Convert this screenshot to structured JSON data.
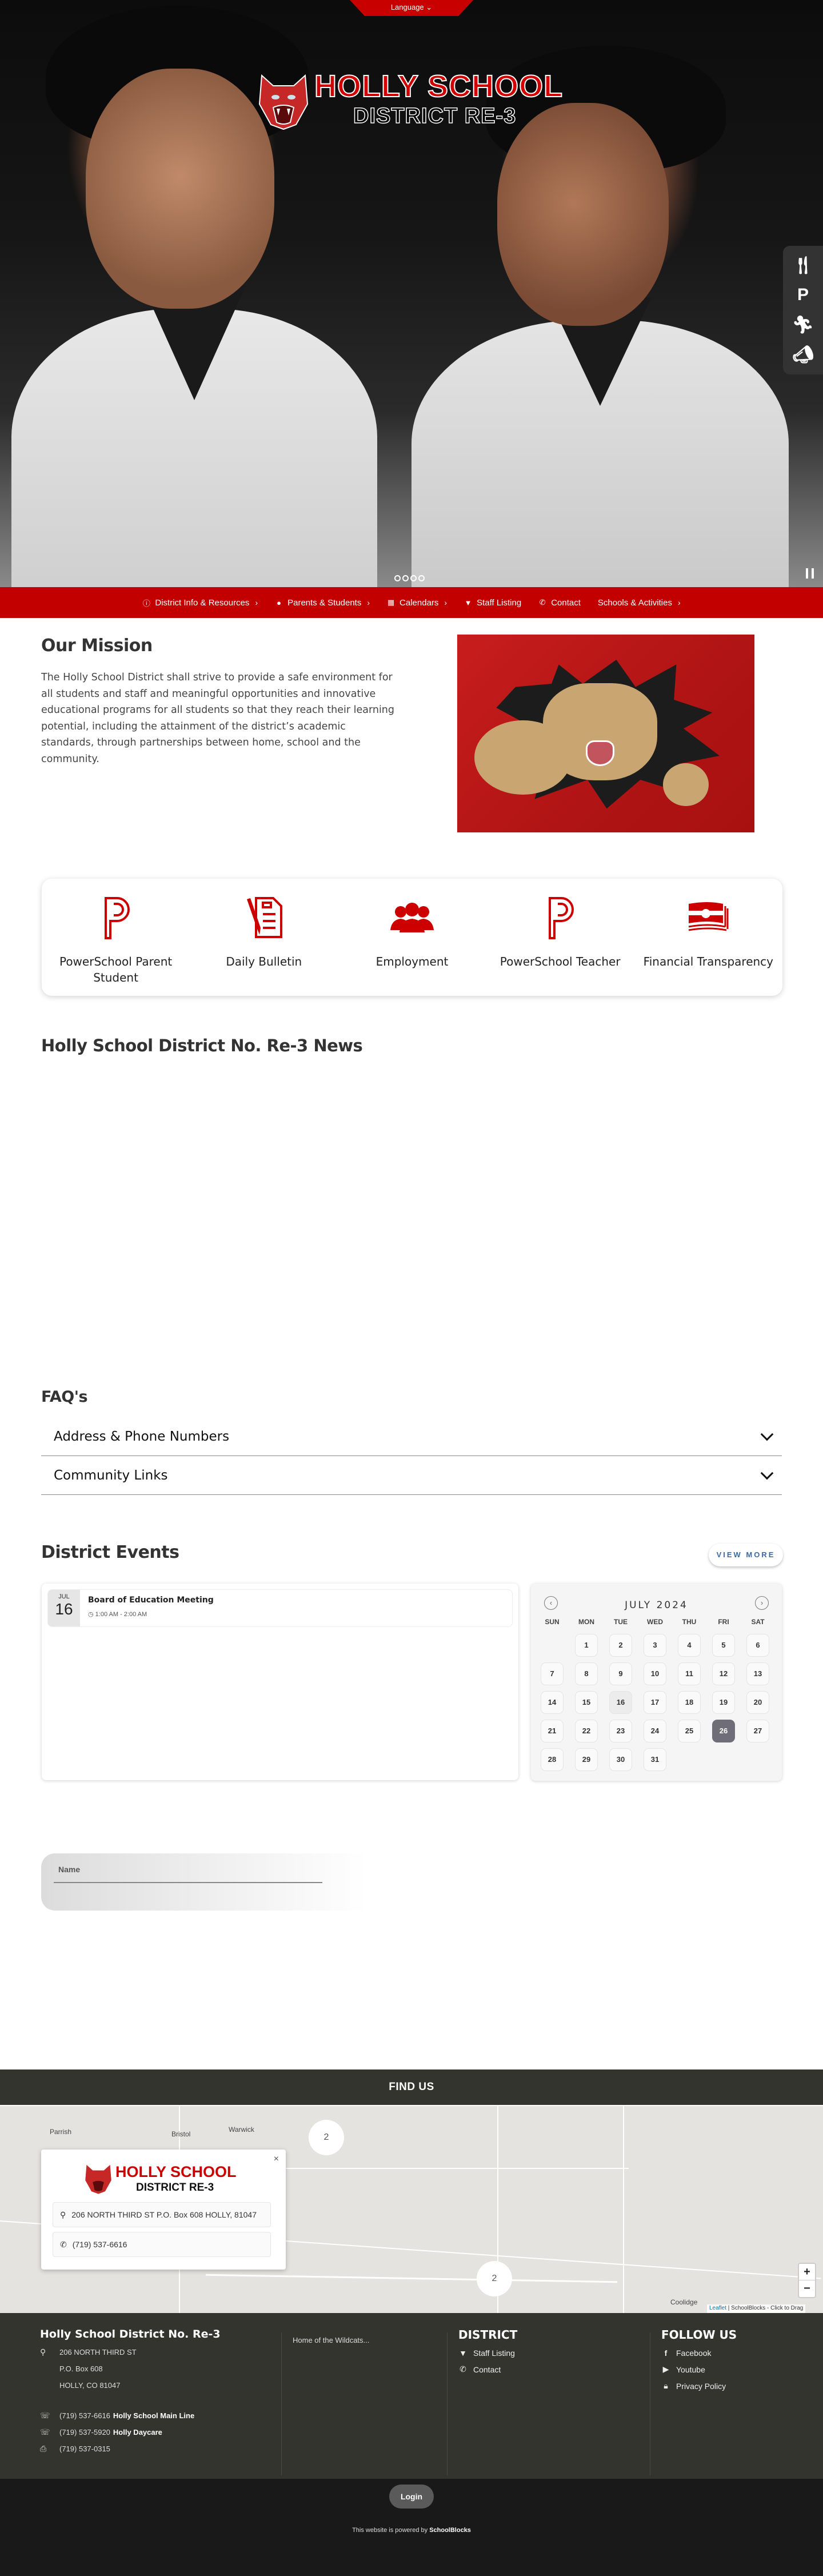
{
  "header": {
    "language_label": "Language",
    "logo_line1": "HOLLY SCHOOL",
    "logo_line2": "DISTRICT RE-3",
    "quick_icons": [
      "fork-knife-icon",
      "powerschool-icon",
      "running-person-icon",
      "megaphone-icon"
    ],
    "slide_count": 4
  },
  "nav": {
    "items": [
      {
        "label": "District Info & Resources",
        "icon": "info-icon",
        "has_submenu": true
      },
      {
        "label": "Parents & Students",
        "icon": "lightbulb-icon",
        "has_submenu": true
      },
      {
        "label": "Calendars",
        "icon": "calendar-icon",
        "has_submenu": true
      },
      {
        "label": "Staff Listing",
        "icon": "chevron-circle-icon",
        "has_submenu": false
      },
      {
        "label": "Contact",
        "icon": "phone-icon",
        "has_submenu": false
      },
      {
        "label": "Schools & Activities",
        "icon": "",
        "has_submenu": true
      }
    ]
  },
  "mission": {
    "title": "Our Mission",
    "body": "The Holly School District shall strive to provide a safe environment for all students and staff and meaningful opportunities and innovative educational programs for all students so that they reach their learning potential, including the attainment of the district’s academic standards, through partnerships between home, school and the community."
  },
  "quick_links": [
    {
      "label": "PowerSchool Parent Student",
      "icon": "powerschool-icon"
    },
    {
      "label": "Daily Bulletin",
      "icon": "bulletin-document-icon"
    },
    {
      "label": "Employment",
      "icon": "users-group-icon"
    },
    {
      "label": "PowerSchool Teacher",
      "icon": "powerschool-icon"
    },
    {
      "label": "Financial Transparency",
      "icon": "money-stack-icon"
    }
  ],
  "news": {
    "title": "Holly School District No. Re-3 News"
  },
  "faq": {
    "title": "FAQ's",
    "items": [
      "Address & Phone Numbers",
      "Community Links"
    ]
  },
  "events": {
    "title": "District Events",
    "view_more": "VIEW MORE",
    "list": [
      {
        "month": "JUL",
        "day": "16",
        "title": "Board of Education Meeting",
        "time": "1:00 AM - 2:00 AM"
      }
    ],
    "calendar": {
      "title": "JULY 2024",
      "weekdays": [
        "SUN",
        "MON",
        "TUE",
        "WED",
        "THU",
        "FRI",
        "SAT"
      ],
      "first_weekday": 1,
      "days_in_month": 31,
      "event_days": [
        16
      ],
      "selected_day": 26
    }
  },
  "form": {
    "name_label": "Name"
  },
  "map": {
    "section_title": "FIND US",
    "towns": [
      "Parrish",
      "Bristol",
      "Warwick",
      "Coolidge"
    ],
    "clusters": [
      "2",
      "2"
    ],
    "popup": {
      "logo_line1": "HOLLY SCHOOL",
      "logo_line2": "DISTRICT RE-3",
      "address": "206 NORTH THIRD ST P.O. Box 608 HOLLY, 81047",
      "phone": "(719) 537-6616",
      "close": "×"
    },
    "zoom_in": "+",
    "zoom_out": "−",
    "attribution_link": "Leaflet",
    "attribution_text": " | SchoolBlocks - Click to Drag"
  },
  "footer": {
    "org_name": "Holly School District No. Re-3",
    "address_lines": [
      "206 NORTH THIRD ST",
      "P.O. Box 608",
      "HOLLY, CO 81047"
    ],
    "phones": [
      {
        "number": "(719) 537-6616",
        "label": "Holly School Main Line",
        "icon": "phone-icon"
      },
      {
        "number": "(719) 537-5920",
        "label": "Holly Daycare",
        "icon": "phone-icon"
      },
      {
        "number": "(719) 537-0315",
        "label": "",
        "icon": "fax-icon"
      }
    ],
    "tagline": "Home of the Wildcats...",
    "district_title": "DISTRICT",
    "district_links": [
      {
        "label": "Staff Listing",
        "icon": "chevron-circle-icon"
      },
      {
        "label": "Contact",
        "icon": "phone-icon"
      }
    ],
    "follow_title": "FOLLOW US",
    "follow_links": [
      {
        "label": "Facebook",
        "icon": "facebook-icon"
      },
      {
        "label": "Youtube",
        "icon": "youtube-icon"
      },
      {
        "label": "Privacy Policy",
        "icon": "lock-icon"
      }
    ],
    "login": "Login",
    "powered_prefix": "This website is powered by ",
    "powered_brand": "SchoolBlocks"
  },
  "colors": {
    "brand_red": "#c20000",
    "footer_bg": "#34342f",
    "bottom_bg": "#191919",
    "link_blue": "#3b6aa0",
    "calendar_selected": "#6e6d78"
  }
}
